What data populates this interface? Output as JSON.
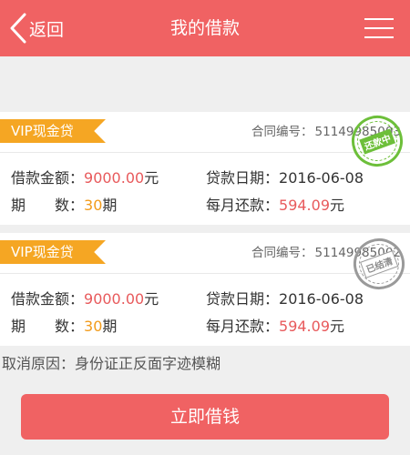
{
  "header": {
    "back_label": "返回",
    "title": "我的借款",
    "back_icon": "chevron-left-icon",
    "menu_icon": "hamburger-menu-icon"
  },
  "loans": [
    {
      "product": "VIP现金贷",
      "contract_label": "合同编号：",
      "contract_no": "51149985003",
      "amount_label": "借款金额：",
      "amount": "9000.00",
      "amount_unit": "元",
      "date_label": "贷款日期：",
      "date": "2016-06-08",
      "periods_label": "期　　数：",
      "periods": "30",
      "periods_unit": "期",
      "monthly_label": "每月还款：",
      "monthly": "594.09",
      "monthly_unit": "元",
      "stamp_text": "还款中",
      "stamp_color": "#6dbf3a"
    },
    {
      "product": "VIP现金贷",
      "contract_label": "合同编号：",
      "contract_no": "51149985002",
      "amount_label": "借款金额：",
      "amount": "9000.00",
      "amount_unit": "元",
      "date_label": "贷款日期：",
      "date": "2016-06-08",
      "periods_label": "期　　数：",
      "periods": "30",
      "periods_unit": "期",
      "monthly_label": "每月还款：",
      "monthly": "594.09",
      "monthly_unit": "元",
      "stamp_text": "已结清",
      "stamp_color": "#9a9a9a"
    }
  ],
  "cancel_reason": "取消原因：身份证正反面字迹模糊",
  "borrow_button": "立即借钱",
  "colors": {
    "primary": "#f06263",
    "tag": "#f5a623",
    "amount_red": "#e85a5c",
    "periods_orange": "#f29b1a"
  }
}
